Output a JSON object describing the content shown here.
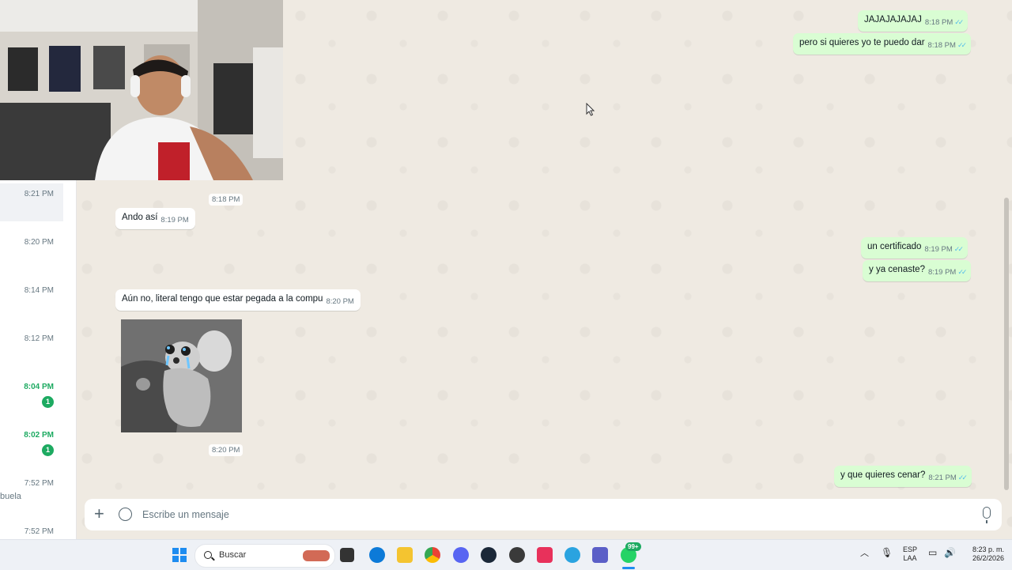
{
  "sidebar": {
    "items": [
      {
        "time": "8:21 PM",
        "unread": false
      },
      {
        "time": "8:20 PM",
        "unread": false
      },
      {
        "time": "8:14 PM",
        "unread": false
      },
      {
        "time": "8:12 PM",
        "unread": false
      },
      {
        "time": "8:04 PM",
        "unread": true,
        "badge": "1"
      },
      {
        "time": "8:02 PM",
        "unread": true,
        "badge": "1"
      },
      {
        "time": "7:52 PM",
        "unread": false
      },
      {
        "time": "7:52 PM",
        "unread": false
      }
    ],
    "snippet": "buela"
  },
  "messages": {
    "out_1": {
      "text": "JAJAJAJAJAJ",
      "time": "8:18 PM"
    },
    "out_2": {
      "text": "pero si quieres yo te puedo dar",
      "time": "8:18 PM"
    },
    "in_img_time": "8:18 PM",
    "in_1": {
      "text": "Ando así",
      "time": "8:19 PM"
    },
    "out_3": {
      "text": "un certificado",
      "time": "8:19 PM"
    },
    "out_4": {
      "text": "y ya cenaste?",
      "time": "8:19 PM"
    },
    "in_2": {
      "text": "Aún no, literal tengo que estar pegada a la compu",
      "time": "8:20 PM"
    },
    "sticker_time": "8:20 PM",
    "out_5": {
      "text": "y que quieres cenar?",
      "time": "8:21 PM"
    }
  },
  "composer": {
    "placeholder": "Escribe un mensaje"
  },
  "taskbar": {
    "search_label": "Buscar",
    "whatsapp_badge": "99+",
    "language_line1": "ESP",
    "language_line2": "LAA",
    "clock_time": "8:23 p. m.",
    "clock_date": "26/2/2026"
  },
  "colors": {
    "accent": "#1daa61",
    "outgoing_bubble": "#d9fdd3",
    "chat_bg": "#efeae2",
    "read_ticks": "#53bdeb"
  }
}
